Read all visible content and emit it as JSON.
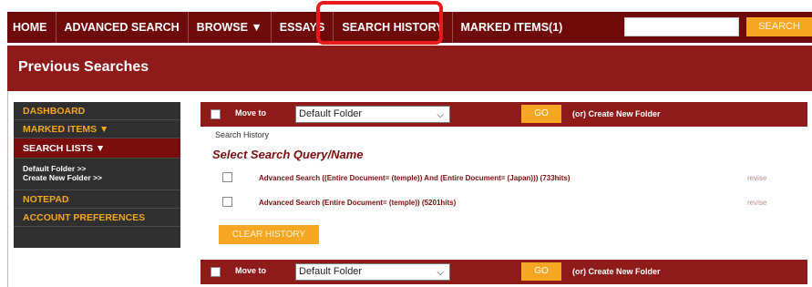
{
  "nav": {
    "items": [
      "HOME",
      "ADVANCED SEARCH",
      "BROWSE ▼",
      "ESSAYS",
      "SEARCH HISTORY",
      "MARKED ITEMS(1)"
    ],
    "search_placeholder": "",
    "search_button": "SEARCH"
  },
  "header": {
    "title": "Previous Searches"
  },
  "sidebar": {
    "items": [
      "DASHBOARD",
      "MARKED ITEMS ▼",
      "SEARCH LISTS ▼",
      "NOTEPAD",
      "ACCOUNT PREFERENCES"
    ],
    "sub_items": [
      "Default Folder >>",
      "Create New Folder >>"
    ]
  },
  "folder_bar": {
    "move_to": "Move to",
    "folder_value": "Default Folder",
    "go": "GO",
    "create": "(or) Create New Folder"
  },
  "history": {
    "label": "Search History",
    "column_header": "Select  Search Query/Name",
    "rows": [
      {
        "query": "Advanced Search ((Entire Document= (temple)) And (Entire Document= (Japan))) (733hits)",
        "action": "revise"
      },
      {
        "query": "Advanced Search (Entire Document= (temple)) (5201hits)",
        "action": "revise"
      }
    ],
    "clear_button": "CLEAR HISTORY"
  },
  "colors": {
    "nav_bg": "#6e0a0a",
    "header_bg": "#8e1a1a",
    "accent": "#f5a623",
    "highlight": "#e81c1c",
    "sidebar_bg": "#2f2f2f"
  }
}
